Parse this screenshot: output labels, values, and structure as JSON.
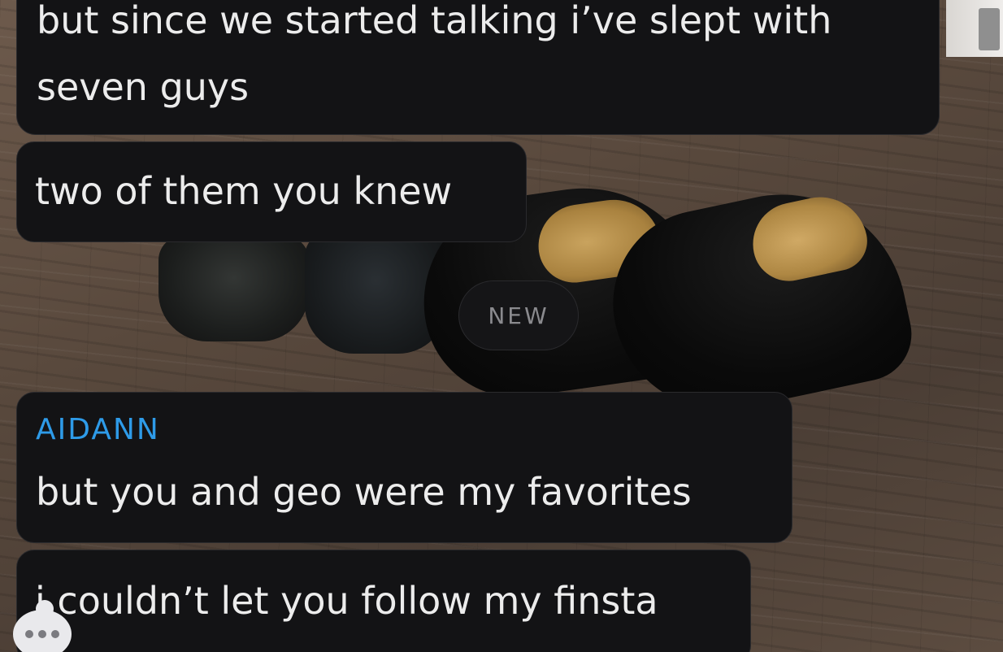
{
  "chat": {
    "new_divider": "NEW",
    "messages": [
      {
        "lines": [
          "but since we started talking i’ve slept with",
          "seven guys"
        ]
      },
      {
        "text": "two of them you knew"
      },
      {
        "sender": "AIDANN",
        "text": "but you and geo were my favorites"
      },
      {
        "text": "i couldn’t let you follow my finsta"
      }
    ],
    "sender_color": "#2e9be8",
    "bubble_color": "#131315"
  }
}
